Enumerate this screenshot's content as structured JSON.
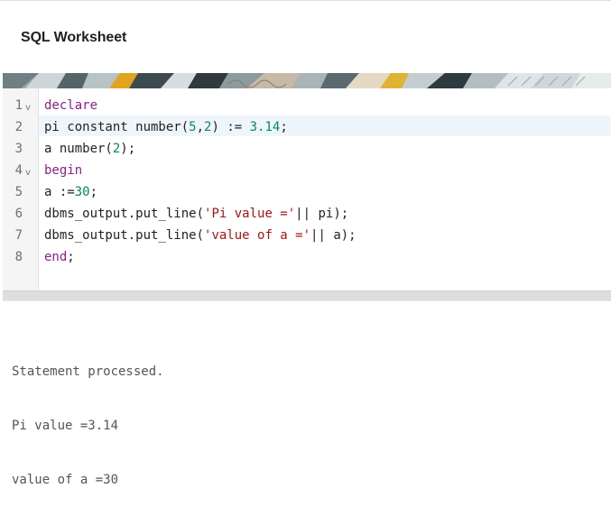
{
  "header": {
    "title": "SQL Worksheet"
  },
  "editor": {
    "lines": [
      {
        "n": "1",
        "fold": "v",
        "segments": [
          {
            "t": "declare",
            "c": "kw"
          }
        ]
      },
      {
        "n": "2",
        "fold": "",
        "segments": [
          {
            "t": "pi constant number(",
            "c": ""
          },
          {
            "t": "5",
            "c": "num"
          },
          {
            "t": ",",
            "c": ""
          },
          {
            "t": "2",
            "c": "num"
          },
          {
            "t": ") := ",
            "c": ""
          },
          {
            "t": "3.14",
            "c": "num"
          },
          {
            "t": ";",
            "c": ""
          }
        ]
      },
      {
        "n": "3",
        "fold": "",
        "segments": [
          {
            "t": "a number(",
            "c": ""
          },
          {
            "t": "2",
            "c": "num"
          },
          {
            "t": ");",
            "c": ""
          }
        ]
      },
      {
        "n": "4",
        "fold": "v",
        "segments": [
          {
            "t": "begin",
            "c": "kw"
          }
        ]
      },
      {
        "n": "5",
        "fold": "",
        "segments": [
          {
            "t": "a :=",
            "c": ""
          },
          {
            "t": "30",
            "c": "num"
          },
          {
            "t": ";",
            "c": ""
          }
        ]
      },
      {
        "n": "6",
        "fold": "",
        "segments": [
          {
            "t": "dbms_output.put_line(",
            "c": ""
          },
          {
            "t": "'Pi value ='",
            "c": "str"
          },
          {
            "t": "|| pi);",
            "c": ""
          }
        ]
      },
      {
        "n": "7",
        "fold": "",
        "segments": [
          {
            "t": "dbms_output.put_line(",
            "c": ""
          },
          {
            "t": "'value of a ='",
            "c": "str"
          },
          {
            "t": "|| a);",
            "c": ""
          }
        ]
      },
      {
        "n": "8",
        "fold": "",
        "segments": [
          {
            "t": "end",
            "c": "kw"
          },
          {
            "t": ";",
            "c": ""
          }
        ]
      }
    ]
  },
  "output": {
    "lines": [
      "Statement processed.",
      "Pi value =3.14",
      "value of a =30"
    ]
  }
}
